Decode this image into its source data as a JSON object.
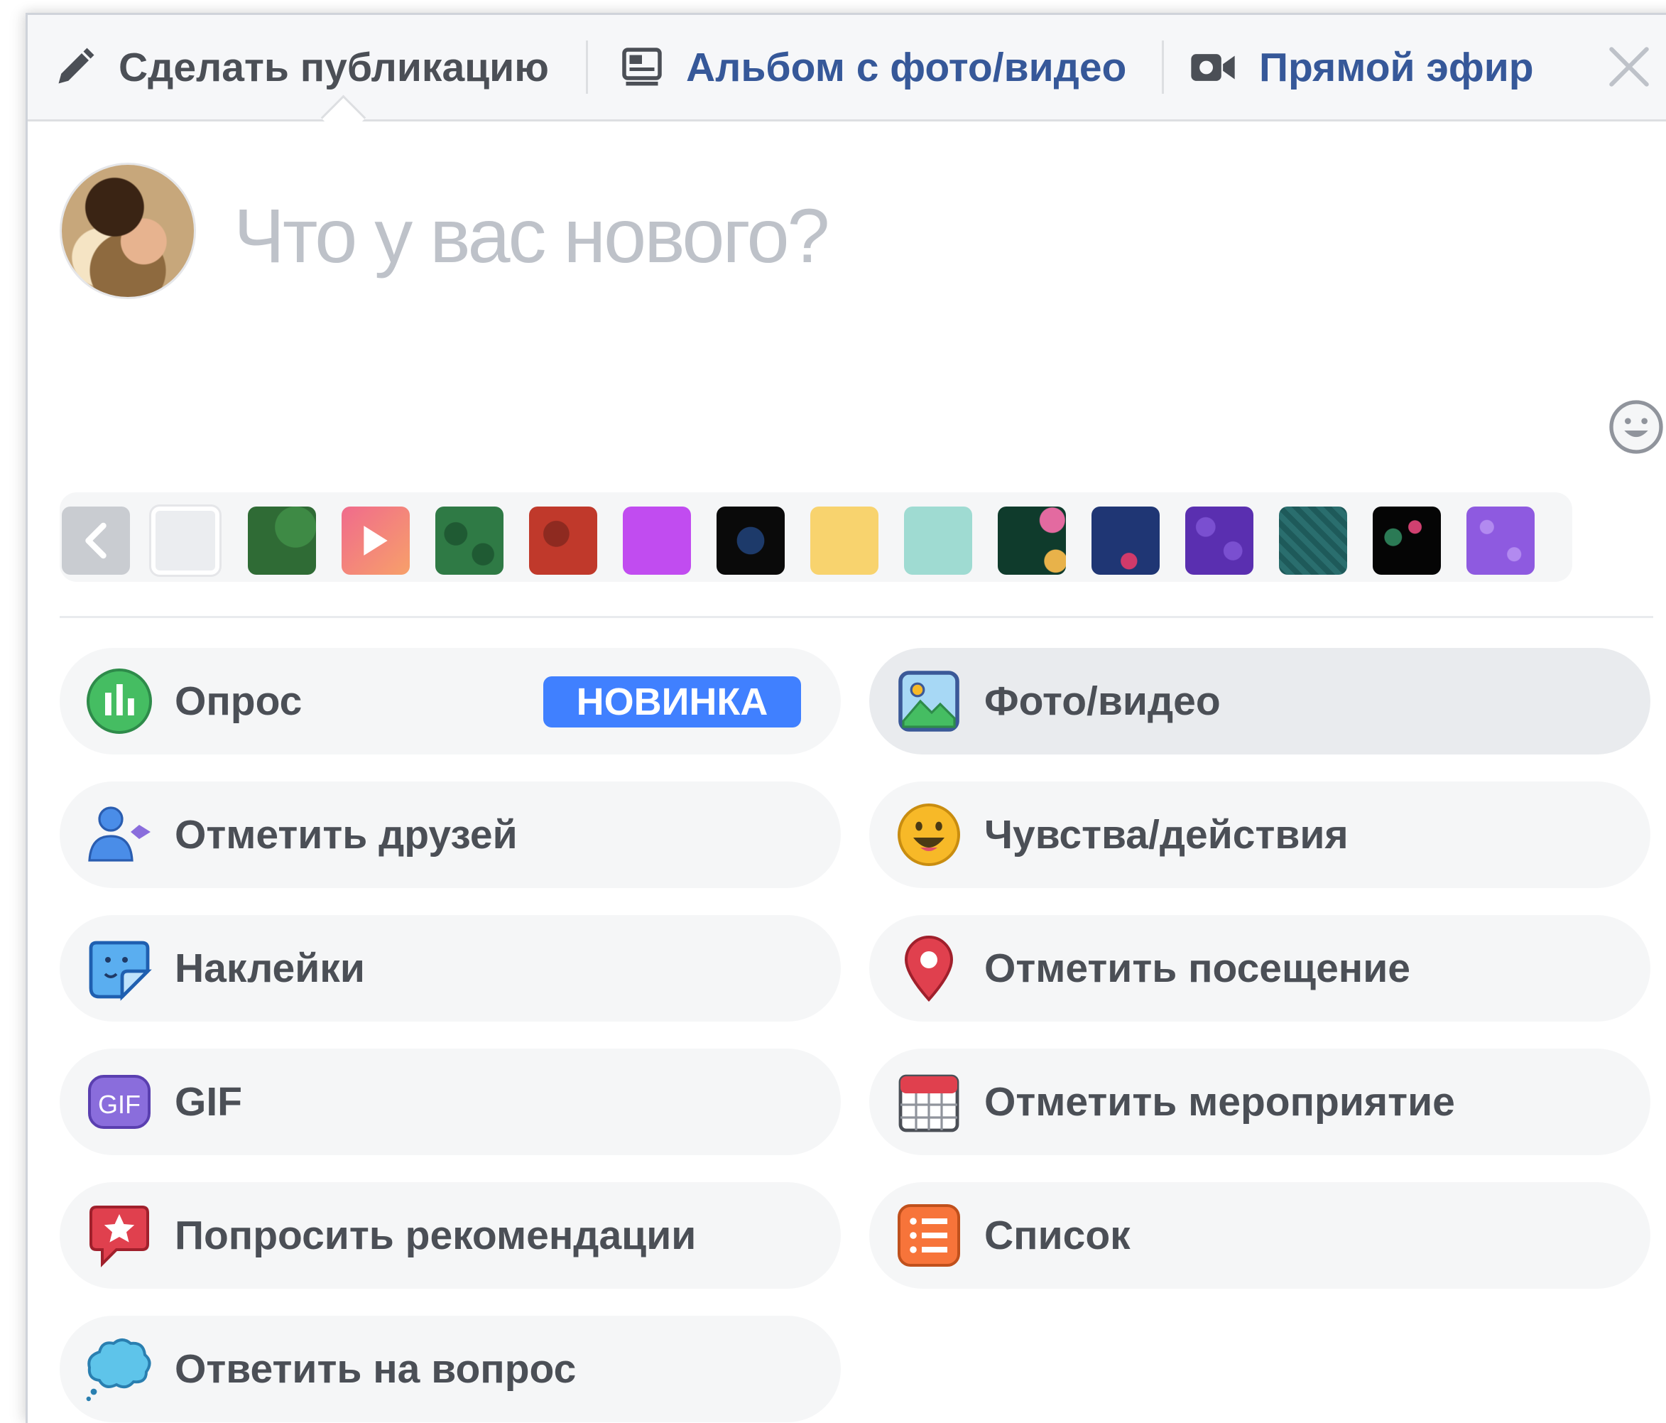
{
  "header": {
    "tabs": [
      {
        "label": "Сделать публикацию",
        "icon": "pencil-icon"
      },
      {
        "label": "Альбом с фото/видео",
        "icon": "album-icon"
      },
      {
        "label": "Прямой эфир",
        "icon": "video-camera-icon"
      }
    ],
    "close_icon": "close-icon"
  },
  "composer": {
    "placeholder": "Что у вас нового?",
    "avatar": "user-avatar",
    "emoji_icon": "smiley-icon"
  },
  "backgrounds": {
    "back_icon": "chevron-left-icon",
    "swatches": [
      "#ebedf0",
      "#2f6b35",
      "#f06b8c",
      "#2f7a45",
      "#c0392b",
      "#c14cf0",
      "#0a0a0a",
      "#f8d36e",
      "#9fdbd2",
      "#0f3b2c",
      "#1f3674",
      "#5a2fb0",
      "#1e5a5a",
      "#050505",
      "#8e5ae0"
    ]
  },
  "actions": {
    "poll": {
      "label": "Опрос",
      "badge": "НОВИНКА"
    },
    "photo_video": {
      "label": "Фото/видео"
    },
    "tag_friends": {
      "label": "Отметить друзей"
    },
    "feeling": {
      "label": "Чувства/действия"
    },
    "stickers": {
      "label": "Наклейки"
    },
    "checkin": {
      "label": "Отметить посещение"
    },
    "gif": {
      "label": "GIF"
    },
    "event": {
      "label": "Отметить мероприятие"
    },
    "recommendations": {
      "label": "Попросить рекомендации"
    },
    "list": {
      "label": "Список"
    },
    "answer_question": {
      "label": "Ответить на вопрос"
    }
  },
  "colors": {
    "link_blue": "#365899",
    "badge_blue": "#4080ff",
    "pill_bg": "#f5f6f7",
    "text_gray": "#4b4f56",
    "placeholder_gray": "#bec2c9"
  }
}
